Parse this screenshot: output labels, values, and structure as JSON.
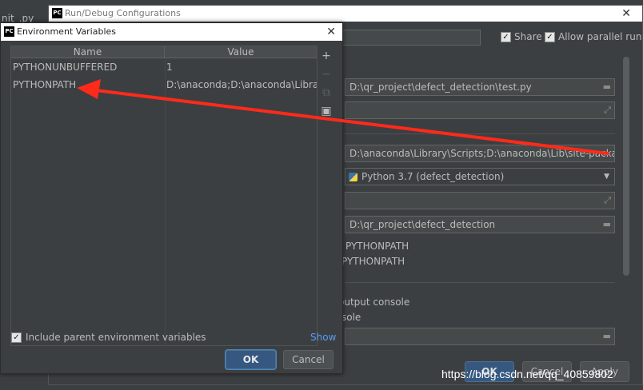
{
  "ide": {
    "tab_label": "nit_.py"
  },
  "run_dialog": {
    "title": "Run/Debug Configurations",
    "share_label": "Share",
    "parallel_label": "Allow parallel run",
    "script_path": "D:\\qr_project\\defect_detection\\test.py",
    "env_vars_value": "D:\\anaconda\\Library\\Scripts;D:\\anaconda\\Lib\\site-packages",
    "interpreter": "Python 3.7 (defect_detection)",
    "working_dir": "D:\\qr_project\\defect_detection",
    "add_content_roots": "PYTHONPATH",
    "add_source_roots": "PYTHONPATH",
    "emulate_terminal": "output console",
    "run_with_console": "sole",
    "ok_label": "OK",
    "cancel_label": "Cancel",
    "apply_label": "Apply"
  },
  "env_dialog": {
    "title": "Environment Variables",
    "columns": {
      "name": "Name",
      "value": "Value"
    },
    "rows": [
      {
        "name": "PYTHONUNBUFFERED",
        "value": "1"
      },
      {
        "name": "PYTHONPATH",
        "value": "D:\\anaconda;D:\\anaconda\\Library..."
      }
    ],
    "include_parent_label": "Include parent environment variables",
    "show_label": "Show",
    "ok_label": "OK",
    "cancel_label": "Cancel"
  },
  "watermark": "https://blog.csdn.net/qq_40859802",
  "colors": {
    "accent": "#365880",
    "link": "#589df6",
    "arrow": "#ff2a1a"
  }
}
